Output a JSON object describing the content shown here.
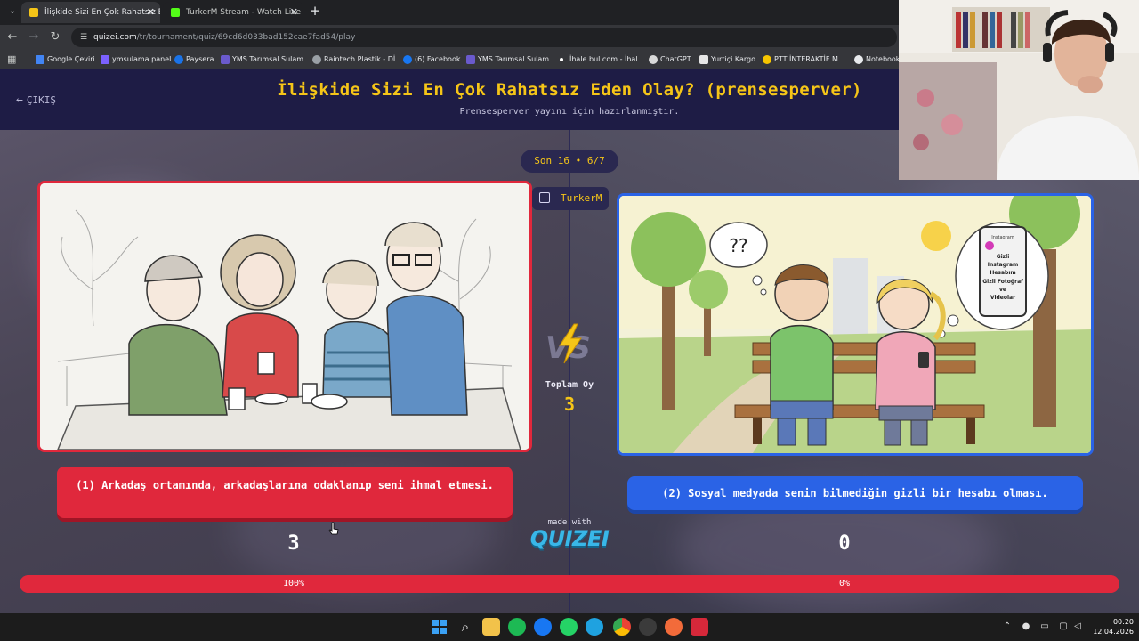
{
  "browser": {
    "tabs": [
      {
        "title": "İlişkide Sizi En Çok Rahatsız Eden",
        "active": true,
        "favicon_color": "#f5c518"
      },
      {
        "title": "TurkerM Stream - Watch Live o",
        "active": false,
        "favicon_color": "#53fc18"
      }
    ],
    "url_host": "quizei.com",
    "url_path": "/tr/tournament/quiz/69cd6d033bad152cae7fad54/play",
    "bookmarks": [
      {
        "label": "Google Çeviri",
        "color": "#4285f4"
      },
      {
        "label": "ymsulama panel",
        "color": "#7b61ff"
      },
      {
        "label": "Paysera",
        "color": "#1a73e8"
      },
      {
        "label": "YMS Tarımsal Sulam...",
        "color": "#6a5acd"
      },
      {
        "label": "Raintech Plastik - Dİ...",
        "color": "#9aa0a6"
      },
      {
        "label": "(6) Facebook",
        "color": "#1877f2"
      },
      {
        "label": "YMS Tarımsal Sulam...",
        "color": "#6a5acd"
      },
      {
        "label": "İhale bul.com - İhal...",
        "color": "#ffffff"
      },
      {
        "label": "ChatGPT",
        "color": "#d9d9d9"
      },
      {
        "label": "Yurtiçi Kargo",
        "color": "#e6e6e6"
      },
      {
        "label": "PTT İNTERAKTİF M...",
        "color": "#f7c600"
      },
      {
        "label": "NotebookL",
        "color": "#e8eaed"
      }
    ]
  },
  "quiz": {
    "exit_label": "ÇIKIŞ",
    "title": "İlişkide Sizi En Çok Rahatsız Eden Olay? (prensesperver)",
    "subtitle": "Prensesperver yayını için hazırlanmıştır.",
    "round": "Son 16 • 6/7",
    "streamer": "TurkerM",
    "total_votes_label": "Toplam Oy",
    "total_votes": "3",
    "made_with": "made with",
    "brand": "QUIZEI",
    "options": [
      {
        "label": "(1) Arkadaş ortamında, arkadaşlarına odaklanıp seni ihmal etmesi.",
        "votes": "3",
        "percent_label": "100%",
        "percent": 100,
        "color": "#e0283c"
      },
      {
        "label": "(2) Sosyal medyada senin bilmediğin gizli bir hesabı olması.",
        "votes": "0",
        "percent_label": "0%",
        "percent": 0,
        "color": "#2a63e6"
      }
    ],
    "illustration_right": {
      "thought_left": "??",
      "phone_header": "Instagram",
      "phone_text": [
        "Gizli",
        "Instagram",
        "Hesabım",
        "Gizli Fotoğraf",
        "ve",
        "Videolar"
      ]
    }
  },
  "taskbar": {
    "time": "00:20",
    "date": "12.04.2026"
  }
}
